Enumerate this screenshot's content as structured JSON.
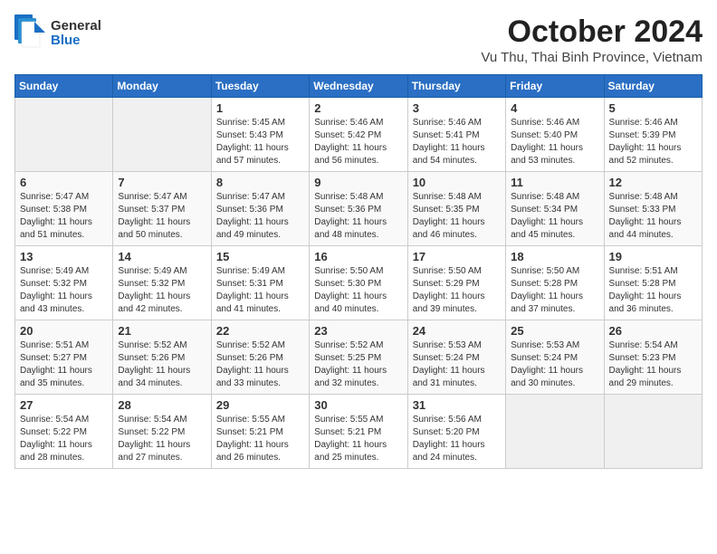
{
  "header": {
    "logo": {
      "general": "General",
      "blue": "Blue"
    },
    "title": "October 2024",
    "location": "Vu Thu, Thai Binh Province, Vietnam"
  },
  "weekdays": [
    "Sunday",
    "Monday",
    "Tuesday",
    "Wednesday",
    "Thursday",
    "Friday",
    "Saturday"
  ],
  "weeks": [
    [
      {
        "day": "",
        "empty": true
      },
      {
        "day": "",
        "empty": true
      },
      {
        "day": "1",
        "sunrise": "5:45 AM",
        "sunset": "5:43 PM",
        "daylight": "11 hours and 57 minutes."
      },
      {
        "day": "2",
        "sunrise": "5:46 AM",
        "sunset": "5:42 PM",
        "daylight": "11 hours and 56 minutes."
      },
      {
        "day": "3",
        "sunrise": "5:46 AM",
        "sunset": "5:41 PM",
        "daylight": "11 hours and 54 minutes."
      },
      {
        "day": "4",
        "sunrise": "5:46 AM",
        "sunset": "5:40 PM",
        "daylight": "11 hours and 53 minutes."
      },
      {
        "day": "5",
        "sunrise": "5:46 AM",
        "sunset": "5:39 PM",
        "daylight": "11 hours and 52 minutes."
      }
    ],
    [
      {
        "day": "6",
        "sunrise": "5:47 AM",
        "sunset": "5:38 PM",
        "daylight": "11 hours and 51 minutes."
      },
      {
        "day": "7",
        "sunrise": "5:47 AM",
        "sunset": "5:37 PM",
        "daylight": "11 hours and 50 minutes."
      },
      {
        "day": "8",
        "sunrise": "5:47 AM",
        "sunset": "5:36 PM",
        "daylight": "11 hours and 49 minutes."
      },
      {
        "day": "9",
        "sunrise": "5:48 AM",
        "sunset": "5:36 PM",
        "daylight": "11 hours and 48 minutes."
      },
      {
        "day": "10",
        "sunrise": "5:48 AM",
        "sunset": "5:35 PM",
        "daylight": "11 hours and 46 minutes."
      },
      {
        "day": "11",
        "sunrise": "5:48 AM",
        "sunset": "5:34 PM",
        "daylight": "11 hours and 45 minutes."
      },
      {
        "day": "12",
        "sunrise": "5:48 AM",
        "sunset": "5:33 PM",
        "daylight": "11 hours and 44 minutes."
      }
    ],
    [
      {
        "day": "13",
        "sunrise": "5:49 AM",
        "sunset": "5:32 PM",
        "daylight": "11 hours and 43 minutes."
      },
      {
        "day": "14",
        "sunrise": "5:49 AM",
        "sunset": "5:32 PM",
        "daylight": "11 hours and 42 minutes."
      },
      {
        "day": "15",
        "sunrise": "5:49 AM",
        "sunset": "5:31 PM",
        "daylight": "11 hours and 41 minutes."
      },
      {
        "day": "16",
        "sunrise": "5:50 AM",
        "sunset": "5:30 PM",
        "daylight": "11 hours and 40 minutes."
      },
      {
        "day": "17",
        "sunrise": "5:50 AM",
        "sunset": "5:29 PM",
        "daylight": "11 hours and 39 minutes."
      },
      {
        "day": "18",
        "sunrise": "5:50 AM",
        "sunset": "5:28 PM",
        "daylight": "11 hours and 37 minutes."
      },
      {
        "day": "19",
        "sunrise": "5:51 AM",
        "sunset": "5:28 PM",
        "daylight": "11 hours and 36 minutes."
      }
    ],
    [
      {
        "day": "20",
        "sunrise": "5:51 AM",
        "sunset": "5:27 PM",
        "daylight": "11 hours and 35 minutes."
      },
      {
        "day": "21",
        "sunrise": "5:52 AM",
        "sunset": "5:26 PM",
        "daylight": "11 hours and 34 minutes."
      },
      {
        "day": "22",
        "sunrise": "5:52 AM",
        "sunset": "5:26 PM",
        "daylight": "11 hours and 33 minutes."
      },
      {
        "day": "23",
        "sunrise": "5:52 AM",
        "sunset": "5:25 PM",
        "daylight": "11 hours and 32 minutes."
      },
      {
        "day": "24",
        "sunrise": "5:53 AM",
        "sunset": "5:24 PM",
        "daylight": "11 hours and 31 minutes."
      },
      {
        "day": "25",
        "sunrise": "5:53 AM",
        "sunset": "5:24 PM",
        "daylight": "11 hours and 30 minutes."
      },
      {
        "day": "26",
        "sunrise": "5:54 AM",
        "sunset": "5:23 PM",
        "daylight": "11 hours and 29 minutes."
      }
    ],
    [
      {
        "day": "27",
        "sunrise": "5:54 AM",
        "sunset": "5:22 PM",
        "daylight": "11 hours and 28 minutes."
      },
      {
        "day": "28",
        "sunrise": "5:54 AM",
        "sunset": "5:22 PM",
        "daylight": "11 hours and 27 minutes."
      },
      {
        "day": "29",
        "sunrise": "5:55 AM",
        "sunset": "5:21 PM",
        "daylight": "11 hours and 26 minutes."
      },
      {
        "day": "30",
        "sunrise": "5:55 AM",
        "sunset": "5:21 PM",
        "daylight": "11 hours and 25 minutes."
      },
      {
        "day": "31",
        "sunrise": "5:56 AM",
        "sunset": "5:20 PM",
        "daylight": "11 hours and 24 minutes."
      },
      {
        "day": "",
        "empty": true
      },
      {
        "day": "",
        "empty": true
      }
    ]
  ],
  "labels": {
    "sunrise": "Sunrise:",
    "sunset": "Sunset:",
    "daylight": "Daylight:"
  }
}
